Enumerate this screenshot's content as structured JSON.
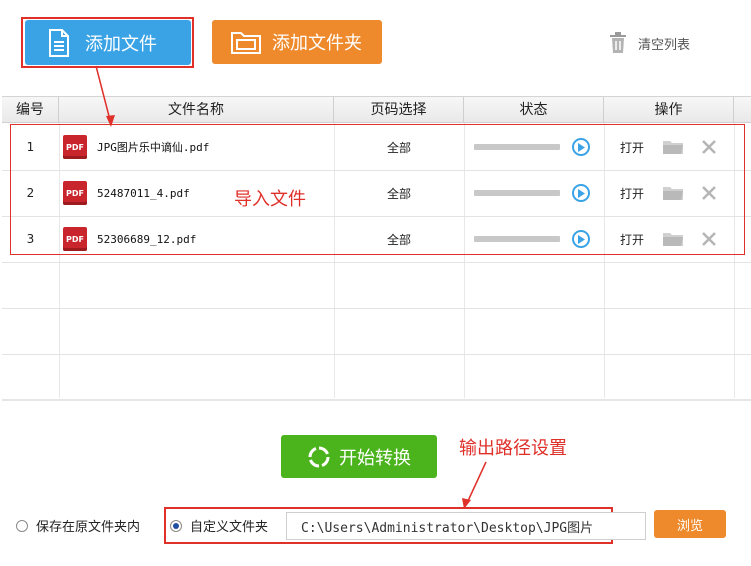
{
  "toolbar": {
    "add_file_label": "添加文件",
    "add_folder_label": "添加文件夹",
    "clear_list_label": "清空列表"
  },
  "table": {
    "headers": [
      "编号",
      "文件名称",
      "页码选择",
      "状态",
      "操作"
    ],
    "rows": [
      {
        "num": "1",
        "file": "JPG图片乐中谪仙.pdf",
        "pages": "全部",
        "open": "打开",
        "icon_text": "PDF"
      },
      {
        "num": "2",
        "file": "52487011_4.pdf",
        "pages": "全部",
        "open": "打开",
        "icon_text": "PDF"
      },
      {
        "num": "3",
        "file": "52306689_12.pdf",
        "pages": "全部",
        "open": "打开",
        "icon_text": "PDF"
      }
    ]
  },
  "annotations": {
    "import_files": "导入文件",
    "output_path_settings": "输出路径设置"
  },
  "actions": {
    "start_convert_label": "开始转换",
    "browse_label": "浏览"
  },
  "output": {
    "option_original": "保存在原文件夹内",
    "option_custom": "自定义文件夹",
    "path_value": "C:\\Users\\Administrator\\Desktop\\JPG图片"
  },
  "colors": {
    "accent_blue": "#3aa3e6",
    "accent_orange": "#ee8a2c",
    "accent_green": "#4bb31c",
    "highlight_red": "#e0302a"
  }
}
